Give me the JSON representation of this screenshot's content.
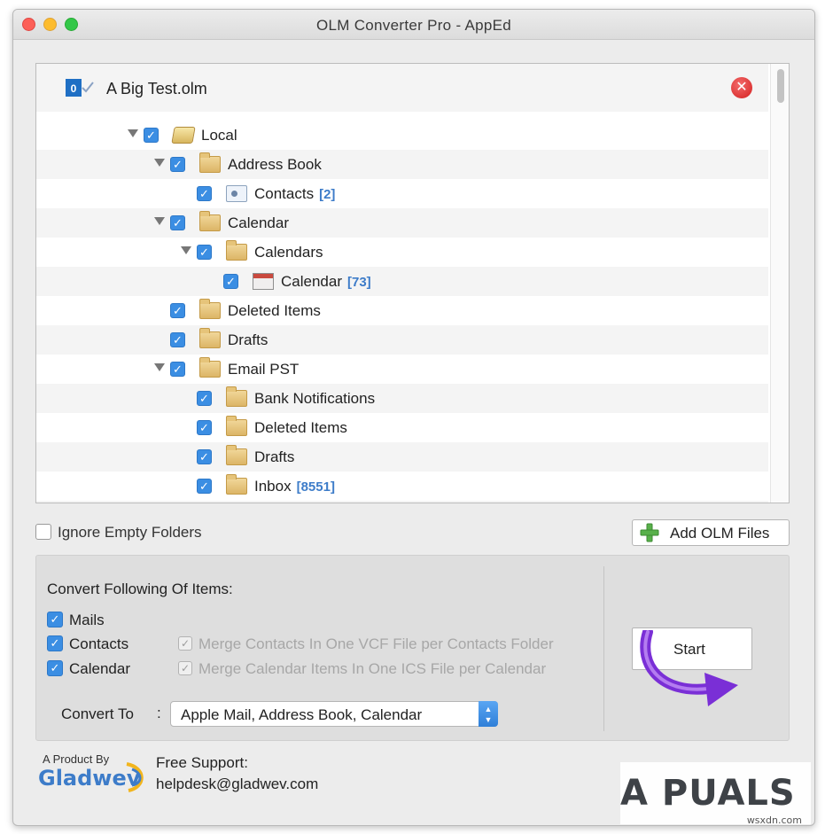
{
  "window": {
    "title": "OLM Converter Pro - AppEd"
  },
  "tree": {
    "file_name": "A Big Test.olm",
    "rows": [
      {
        "label": "Local",
        "count": ""
      },
      {
        "label": "Address Book",
        "count": ""
      },
      {
        "label": "Contacts",
        "count": "[2]"
      },
      {
        "label": "Calendar",
        "count": ""
      },
      {
        "label": "Calendars",
        "count": ""
      },
      {
        "label": "Calendar",
        "count": "[73]"
      },
      {
        "label": "Deleted Items",
        "count": ""
      },
      {
        "label": "Drafts",
        "count": ""
      },
      {
        "label": "Email PST",
        "count": ""
      },
      {
        "label": "Bank Notifications",
        "count": ""
      },
      {
        "label": "Deleted Items",
        "count": ""
      },
      {
        "label": "Drafts",
        "count": ""
      },
      {
        "label": "Inbox",
        "count": "[8551]"
      }
    ]
  },
  "options": {
    "ignore_empty_label": "Ignore Empty Folders",
    "add_olm_label": "Add OLM Files"
  },
  "convert": {
    "title": "Convert Following Of Items:",
    "mails_label": "Mails",
    "contacts_label": "Contacts",
    "calendar_label": "Calendar",
    "merge_contacts_label": "Merge Contacts In One VCF File per Contacts Folder",
    "merge_calendar_label": "Merge Calendar Items In One ICS File per Calendar",
    "convert_to_label": "Convert To",
    "colon": ":",
    "convert_to_value": "Apple Mail, Address Book, Calendar",
    "start_label": "Start"
  },
  "footer": {
    "product_by": "A Product By",
    "logo_text": "Gladwev",
    "support_title": "Free Support:",
    "support_email": "helpdesk@gladwev.com"
  },
  "watermark": {
    "text": "A PUALS",
    "domain": "wsxdn.com"
  },
  "colors": {
    "accent": "#3b8ee3",
    "count": "#3d7cc9",
    "start_arrow": "#8a2be2"
  }
}
